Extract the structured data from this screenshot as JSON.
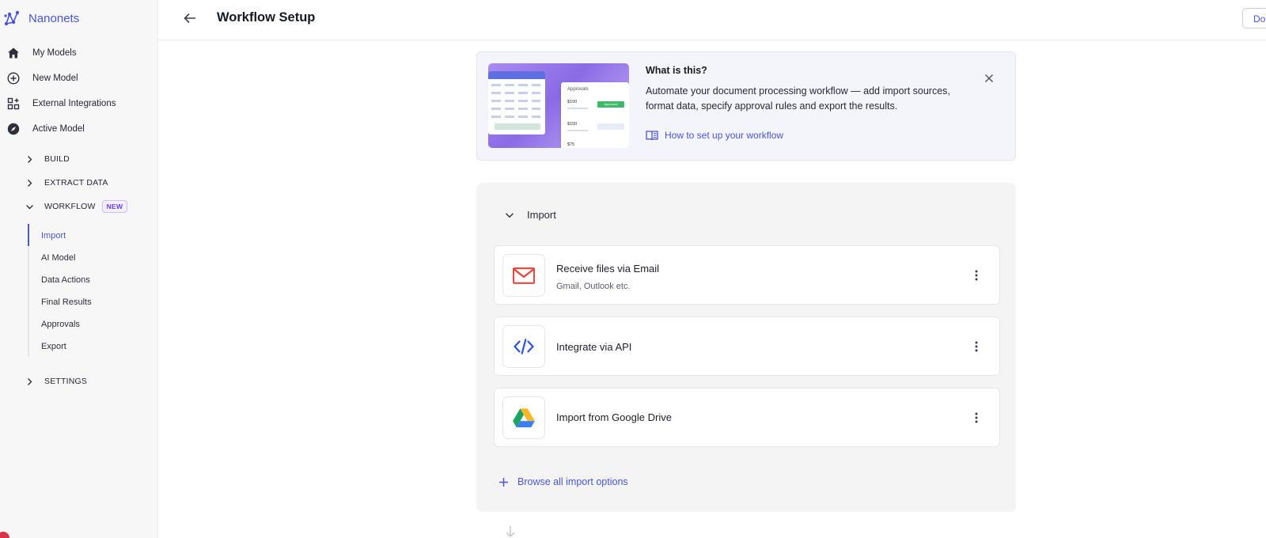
{
  "brand": {
    "name": "Nanonets",
    "color": "#4a55d8"
  },
  "sidebar": {
    "main_items": [
      {
        "label": "My Models",
        "icon": "home-icon"
      },
      {
        "label": "New Model",
        "icon": "plus-circle-icon"
      },
      {
        "label": "External Integrations",
        "icon": "grid-add-icon"
      },
      {
        "label": "Active Model",
        "icon": "compass-icon"
      }
    ],
    "sections": [
      {
        "label": "BUILD",
        "expanded": false
      },
      {
        "label": "EXTRACT DATA",
        "expanded": false
      },
      {
        "label": "WORKFLOW",
        "expanded": true,
        "badge": "NEW"
      },
      {
        "label": "SETTINGS",
        "expanded": false
      }
    ],
    "workflow_items": [
      {
        "label": "Import",
        "active": true
      },
      {
        "label": "AI Model",
        "active": false
      },
      {
        "label": "Data Actions",
        "active": false
      },
      {
        "label": "Final Results",
        "active": false
      },
      {
        "label": "Approvals",
        "active": false
      },
      {
        "label": "Export",
        "active": false
      }
    ]
  },
  "header": {
    "title": "Workflow Setup",
    "button_label": "Do"
  },
  "info": {
    "title": "What is this?",
    "text": "Automate your document processing workflow — add import sources, format data, specify approval rules and export the results.",
    "link": "How to set up your workflow",
    "thumbnail": {
      "title": "Approvals",
      "amounts": [
        "$100",
        "$150",
        "$75"
      ],
      "approved": "Approved"
    }
  },
  "import_panel": {
    "title": "Import",
    "sources": [
      {
        "title": "Receive files via Email",
        "subtitle": "Gmail, Outlook etc.",
        "icon": "gmail-icon"
      },
      {
        "title": "Integrate via API",
        "subtitle": "",
        "icon": "code-icon"
      },
      {
        "title": "Import from Google Drive",
        "subtitle": "",
        "icon": "google-drive-icon"
      }
    ],
    "browse_label": "Browse all import options"
  },
  "colors": {
    "accent": "#4a55d8",
    "badge": "#6a41d8",
    "sidebar_bg": "#f7f7f8",
    "info_bg": "#f4f4fb",
    "panel_bg": "#f4f4f5"
  }
}
